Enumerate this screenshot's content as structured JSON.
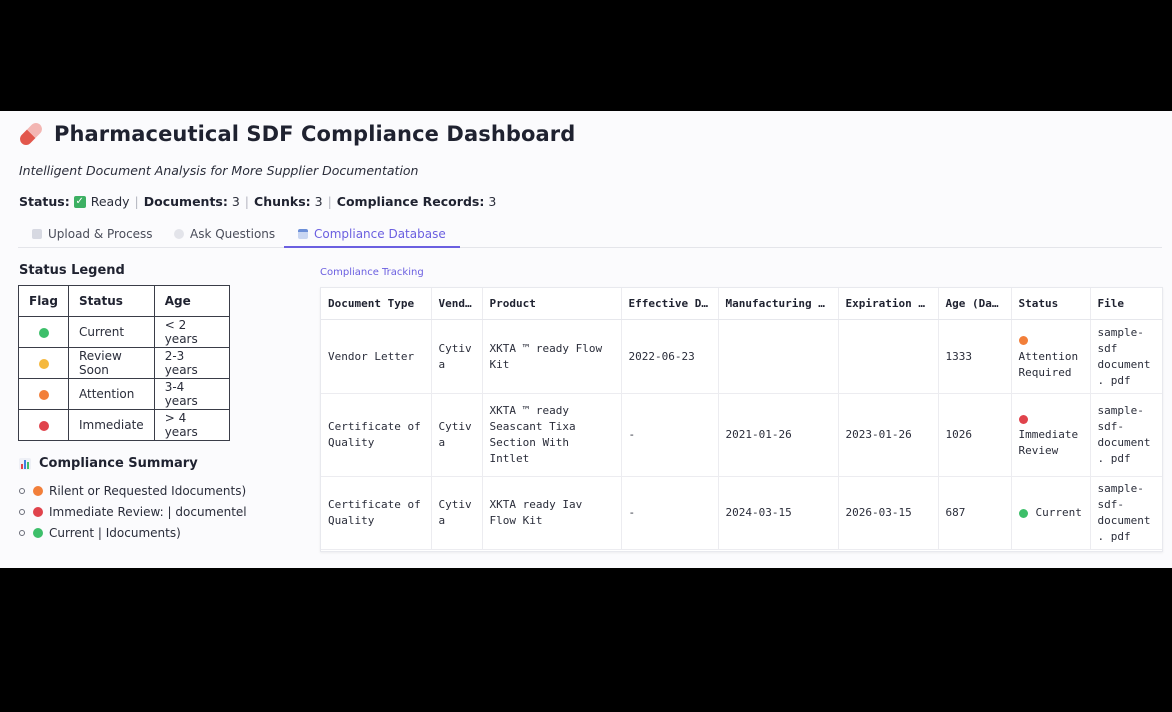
{
  "header": {
    "title": "Pharmaceutical SDF Compliance Dashboard",
    "subtitle": "Intelligent Document Analysis for More Supplier Documentation"
  },
  "statusline": {
    "status_label": "Status:",
    "status_value": "Ready",
    "documents_label": "Documents:",
    "documents_value": "3",
    "chunks_label": "Chunks:",
    "chunks_value": "3",
    "records_label": "Compliance Records:",
    "records_value": "3",
    "separator": "|"
  },
  "tabs": [
    {
      "label": "Upload & Process",
      "icon": "document-icon"
    },
    {
      "label": "Ask Questions",
      "icon": "speech-bubble-icon"
    },
    {
      "label": "Compliance Database",
      "icon": "calendar-icon",
      "active": true
    }
  ],
  "legend": {
    "title": "Status Legend",
    "headers": [
      "Flag",
      "Status",
      "Age"
    ],
    "rows": [
      {
        "color": "#3dbf6a",
        "status": "Current",
        "age": "< 2 years"
      },
      {
        "color": "#f5b83d",
        "status": "Review Soon",
        "age": "2-3 years"
      },
      {
        "color": "#f27f3a",
        "status": "Attention",
        "age": "3-4 years"
      },
      {
        "color": "#e0434c",
        "status": "Immediate",
        "age": "> 4 years"
      }
    ]
  },
  "summary": {
    "title": "Compliance Summary",
    "items": [
      {
        "color": "#f27f3a",
        "text": "Rilent or Requested Idocuments)"
      },
      {
        "color": "#e0434c",
        "text": "Immediate Review: | documentel"
      },
      {
        "color": "#3dbf6a",
        "text": "Current | Idocuments)"
      }
    ]
  },
  "tracking": {
    "label": "Compliance Tracking",
    "columns": [
      "Document Type",
      "Vendor",
      "Product",
      "Effective Date",
      "Manufacturing Date",
      "Expiration Date",
      "Age (Days)",
      "Status",
      "File"
    ],
    "column_display": [
      "Document Type",
      "Vend…",
      "Product",
      "Effective D…",
      "Manufacturing D…",
      "Expiration D…",
      "Age (Day…",
      "Status",
      "File"
    ],
    "rows": [
      {
        "doc_type": "Vendor Letter",
        "vendor": "Cytiv a",
        "product": "XKTA ™ ready Flow Kit",
        "effective": "2022-06-23",
        "manufacturing": "",
        "expiration": "",
        "age": "1333",
        "status_color": "#f27f3a",
        "status": "Attention Required",
        "file": "sample- sdf document. pdf"
      },
      {
        "doc_type": "Certificate of Quality",
        "vendor": "Cytiv a",
        "product": "XKTA ™ ready Seascant Tixa Section With Intlet",
        "effective": "-",
        "manufacturing": "2021-01-26",
        "expiration": "2023-01-26",
        "age": "1026",
        "status_color": "#e0434c",
        "status": "Immediate Review",
        "file": "sample- sdf- document. pdf"
      },
      {
        "doc_type": "Certificate of Quality",
        "vendor": "Cytiv a",
        "product": "XKTA ready Iav Flow Kit",
        "effective": "-",
        "manufacturing": "2024-03-15",
        "expiration": "2026-03-15",
        "age": "687",
        "status_color": "#3dbf6a",
        "status": "Current",
        "file": "sample- sdf- document. pdf"
      }
    ]
  }
}
